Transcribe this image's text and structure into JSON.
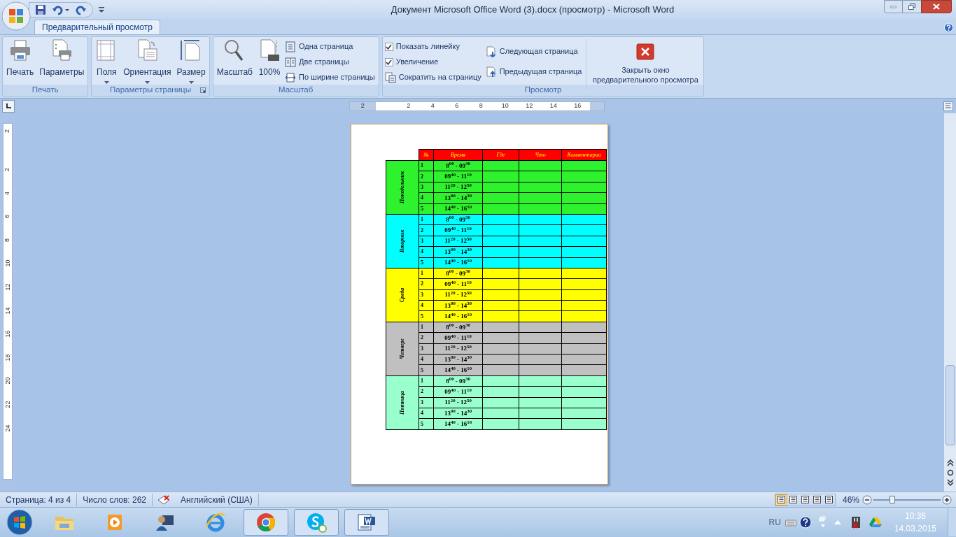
{
  "window": {
    "title": "Документ Microsoft Office Word (3).docx (просмотр) - Microsoft Word"
  },
  "tabs": [
    {
      "label": "Предварительный просмотр",
      "selected": true
    }
  ],
  "ribbon_groups": [
    {
      "label": "Печать",
      "items": [
        {
          "kind": "large",
          "label": "Печать"
        },
        {
          "kind": "large",
          "label": "Параметры"
        }
      ]
    },
    {
      "label": "Параметры страницы",
      "items": [
        {
          "kind": "large",
          "label": "Поля",
          "dropdown": true
        },
        {
          "kind": "large",
          "label": "Ориентация",
          "dropdown": true
        },
        {
          "kind": "large",
          "label": "Размер",
          "dropdown": true
        }
      ]
    },
    {
      "label": "Масштаб",
      "items": [
        {
          "kind": "large",
          "label": "Масштаб"
        },
        {
          "kind": "large",
          "label": "100%"
        },
        {
          "kind": "stack",
          "items": [
            {
              "label": "Одна страница"
            },
            {
              "label": "Две страницы"
            },
            {
              "label": "По ширине страницы"
            }
          ]
        }
      ]
    },
    {
      "label": "Просмотр",
      "items": [
        {
          "kind": "stack",
          "items": [
            {
              "label": "Показать линейку",
              "checked": true
            },
            {
              "label": "Увеличение",
              "checked": true
            },
            {
              "label": "Сократить на страницу"
            }
          ]
        },
        {
          "kind": "stack",
          "items": [
            {
              "label": "Следующая страница"
            },
            {
              "label": "Предыдущая страница"
            }
          ]
        },
        {
          "kind": "close",
          "label": "Закрыть окно предварительного просмотра"
        }
      ]
    }
  ],
  "ruler": {
    "horizontal": [
      "2",
      "2",
      "4",
      "6",
      "8",
      "10",
      "12",
      "14",
      "16"
    ],
    "vertical": [
      "2",
      "2",
      "4",
      "6",
      "8",
      "10",
      "12",
      "14",
      "16",
      "18",
      "20",
      "22",
      "24"
    ]
  },
  "table": {
    "columns": [
      "№",
      "Время",
      "Где",
      "Что",
      "Комментарии"
    ],
    "days": [
      {
        "day": "Понедельник",
        "color": "#2ef22e",
        "rows": [
          {
            "number": "1",
            "time": "8$^{00}$ - 09$^{30}$"
          },
          {
            "number": "2",
            "time": "09$^{40}$ - 11$^{10}$"
          },
          {
            "number": "3",
            "time": "11$^{20}$ - 12$^{50}$"
          },
          {
            "number": "4",
            "time": "13$^{00}$ - 14$^{30}$"
          },
          {
            "number": "5",
            "time": "14$^{40}$ - 16$^{10}$"
          }
        ]
      },
      {
        "day": "Вторник",
        "color": "#00ffff",
        "rows": [
          {
            "number": "1",
            "time": "8$^{00}$ - 09$^{30}$"
          },
          {
            "number": "2",
            "time": "09$^{40}$ - 11$^{10}$"
          },
          {
            "number": "3",
            "time": "11$^{20}$ - 12$^{50}$"
          },
          {
            "number": "4",
            "time": "13$^{00}$ - 14$^{30}$"
          },
          {
            "number": "5",
            "time": "14$^{40}$ - 16$^{10}$"
          }
        ]
      },
      {
        "day": "Среда",
        "color": "#ffff00",
        "rows": [
          {
            "number": "1",
            "time": "8$^{00}$ - 09$^{30}$"
          },
          {
            "number": "2",
            "time": "09$^{40}$ - 11$^{10}$"
          },
          {
            "number": "3",
            "time": "11$^{20}$ - 12$^{50}$"
          },
          {
            "number": "4",
            "time": "13$^{00}$ - 14$^{30}$"
          },
          {
            "number": "5",
            "time": "14$^{40}$ - 16$^{10}$"
          }
        ]
      },
      {
        "day": "Четверг",
        "color": "#c0c0c0",
        "rows": [
          {
            "number": "1",
            "time": "8$^{00}$ - 09$^{30}$"
          },
          {
            "number": "2",
            "time": "09$^{40}$ - 11$^{10}$"
          },
          {
            "number": "3",
            "time": "11$^{20}$ - 12$^{50}$"
          },
          {
            "number": "4",
            "time": "13$^{00}$ - 14$^{30}$"
          },
          {
            "number": "5",
            "time": "14$^{40}$ - 16$^{10}$"
          }
        ]
      },
      {
        "day": "Пятница",
        "color": "#99ffcc",
        "rows": [
          {
            "number": "1",
            "time": "8$^{00}$ - 09$^{30}$"
          },
          {
            "number": "2",
            "time": "09$^{40}$ - 11$^{10}$"
          },
          {
            "number": "3",
            "time": "11$^{20}$ - 12$^{50}$"
          },
          {
            "number": "4",
            "time": "13$^{00}$ - 14$^{30}$"
          },
          {
            "number": "5",
            "time": "14$^{40}$ - 16$^{10}$"
          }
        ]
      }
    ]
  },
  "status_bar": {
    "page": "Страница: 4 из 4",
    "words": "Число слов: 262",
    "language": "Английский (США)",
    "zoom": "46%",
    "level": 0.24,
    "views": [
      {
        "selected": true
      },
      {
        "selected": false
      },
      {
        "selected": false
      },
      {
        "selected": false
      },
      {
        "selected": false
      }
    ]
  },
  "taskbar": {
    "apps": [
      {
        "open": false
      },
      {
        "open": false
      },
      {
        "open": false
      },
      {
        "open": false
      },
      {
        "open": true
      },
      {
        "open": true
      },
      {
        "open": true
      }
    ],
    "language": "RU",
    "time": "10:36",
    "date": "14.03.2015"
  }
}
